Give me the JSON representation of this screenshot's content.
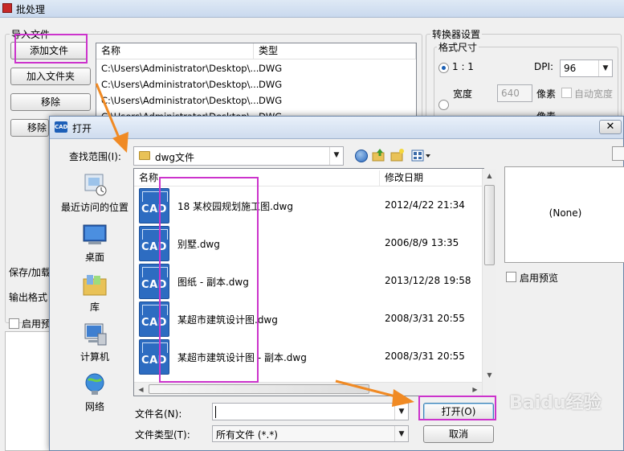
{
  "bg_window": {
    "title": "批处理",
    "import_group": "导入文件",
    "buttons": {
      "add_file": "添加文件",
      "add_folder": "加入文件夹",
      "remove": "移除",
      "remove_partial": "移除"
    },
    "file_list": {
      "columns": [
        "名称",
        "类型"
      ],
      "rows": [
        {
          "name": "C:\\Users\\Administrator\\Desktop\\...",
          "type": "DWG"
        },
        {
          "name": "C:\\Users\\Administrator\\Desktop\\...",
          "type": "DWG"
        },
        {
          "name": "C:\\Users\\Administrator\\Desktop\\...",
          "type": "DWG"
        },
        {
          "name": "C:\\Users\\Administrator\\Desktop\\...",
          "type": "DWG"
        }
      ]
    },
    "converter_group": "转换器设置",
    "format_size_group": "格式尺寸",
    "ratio_label": "1 : 1",
    "dpi_label": "DPI:",
    "dpi_value": "96",
    "width_label": "宽度",
    "width_value": "640",
    "pixel_label": "像素",
    "auto_width_label": "自动宽度",
    "pixel_label_2": "像素",
    "save_label": "保存/加载",
    "output_format_label": "输出格式",
    "enable_label": "启用预"
  },
  "dialog": {
    "title": "打开",
    "icon_text": "CAD",
    "close": "✕",
    "look_in_label": "查找范围(I):",
    "look_in_value": "dwg文件",
    "places": [
      {
        "label": "最近访问的位置",
        "icon": "recent-places-icon"
      },
      {
        "label": "桌面",
        "icon": "desktop-icon"
      },
      {
        "label": "库",
        "icon": "library-icon"
      },
      {
        "label": "计算机",
        "icon": "computer-icon"
      },
      {
        "label": "网络",
        "icon": "network-icon"
      }
    ],
    "columns": {
      "name": "名称",
      "date": "修改日期"
    },
    "files": [
      {
        "name": "18 某校园规划施工图.dwg",
        "date": "2012/4/22 21:34"
      },
      {
        "name": "别墅.dwg",
        "date": "2006/8/9 13:35"
      },
      {
        "name": "图纸 - 副本.dwg",
        "date": "2013/12/28 19:58"
      },
      {
        "name": "某超市建筑设计图.dwg",
        "date": "2008/3/31 20:55"
      },
      {
        "name": "某超市建筑设计图 - 副本.dwg",
        "date": "2008/3/31 20:55"
      }
    ],
    "cad_icon_text": "CAD",
    "preview_text": "(None)",
    "enable_preview_label": "启用预览",
    "filename_label": "文件名(N):",
    "filename_value": "",
    "filetype_label": "文件类型(T):",
    "filetype_value": "所有文件 (*.*)",
    "open_button": "打开(O)",
    "cancel_button": "取消"
  },
  "watermark": "Baidu经验",
  "colors": {
    "highlight": "#cc33cc",
    "arrow": "#f08a24",
    "cad_blue": "#2d6cc1"
  }
}
